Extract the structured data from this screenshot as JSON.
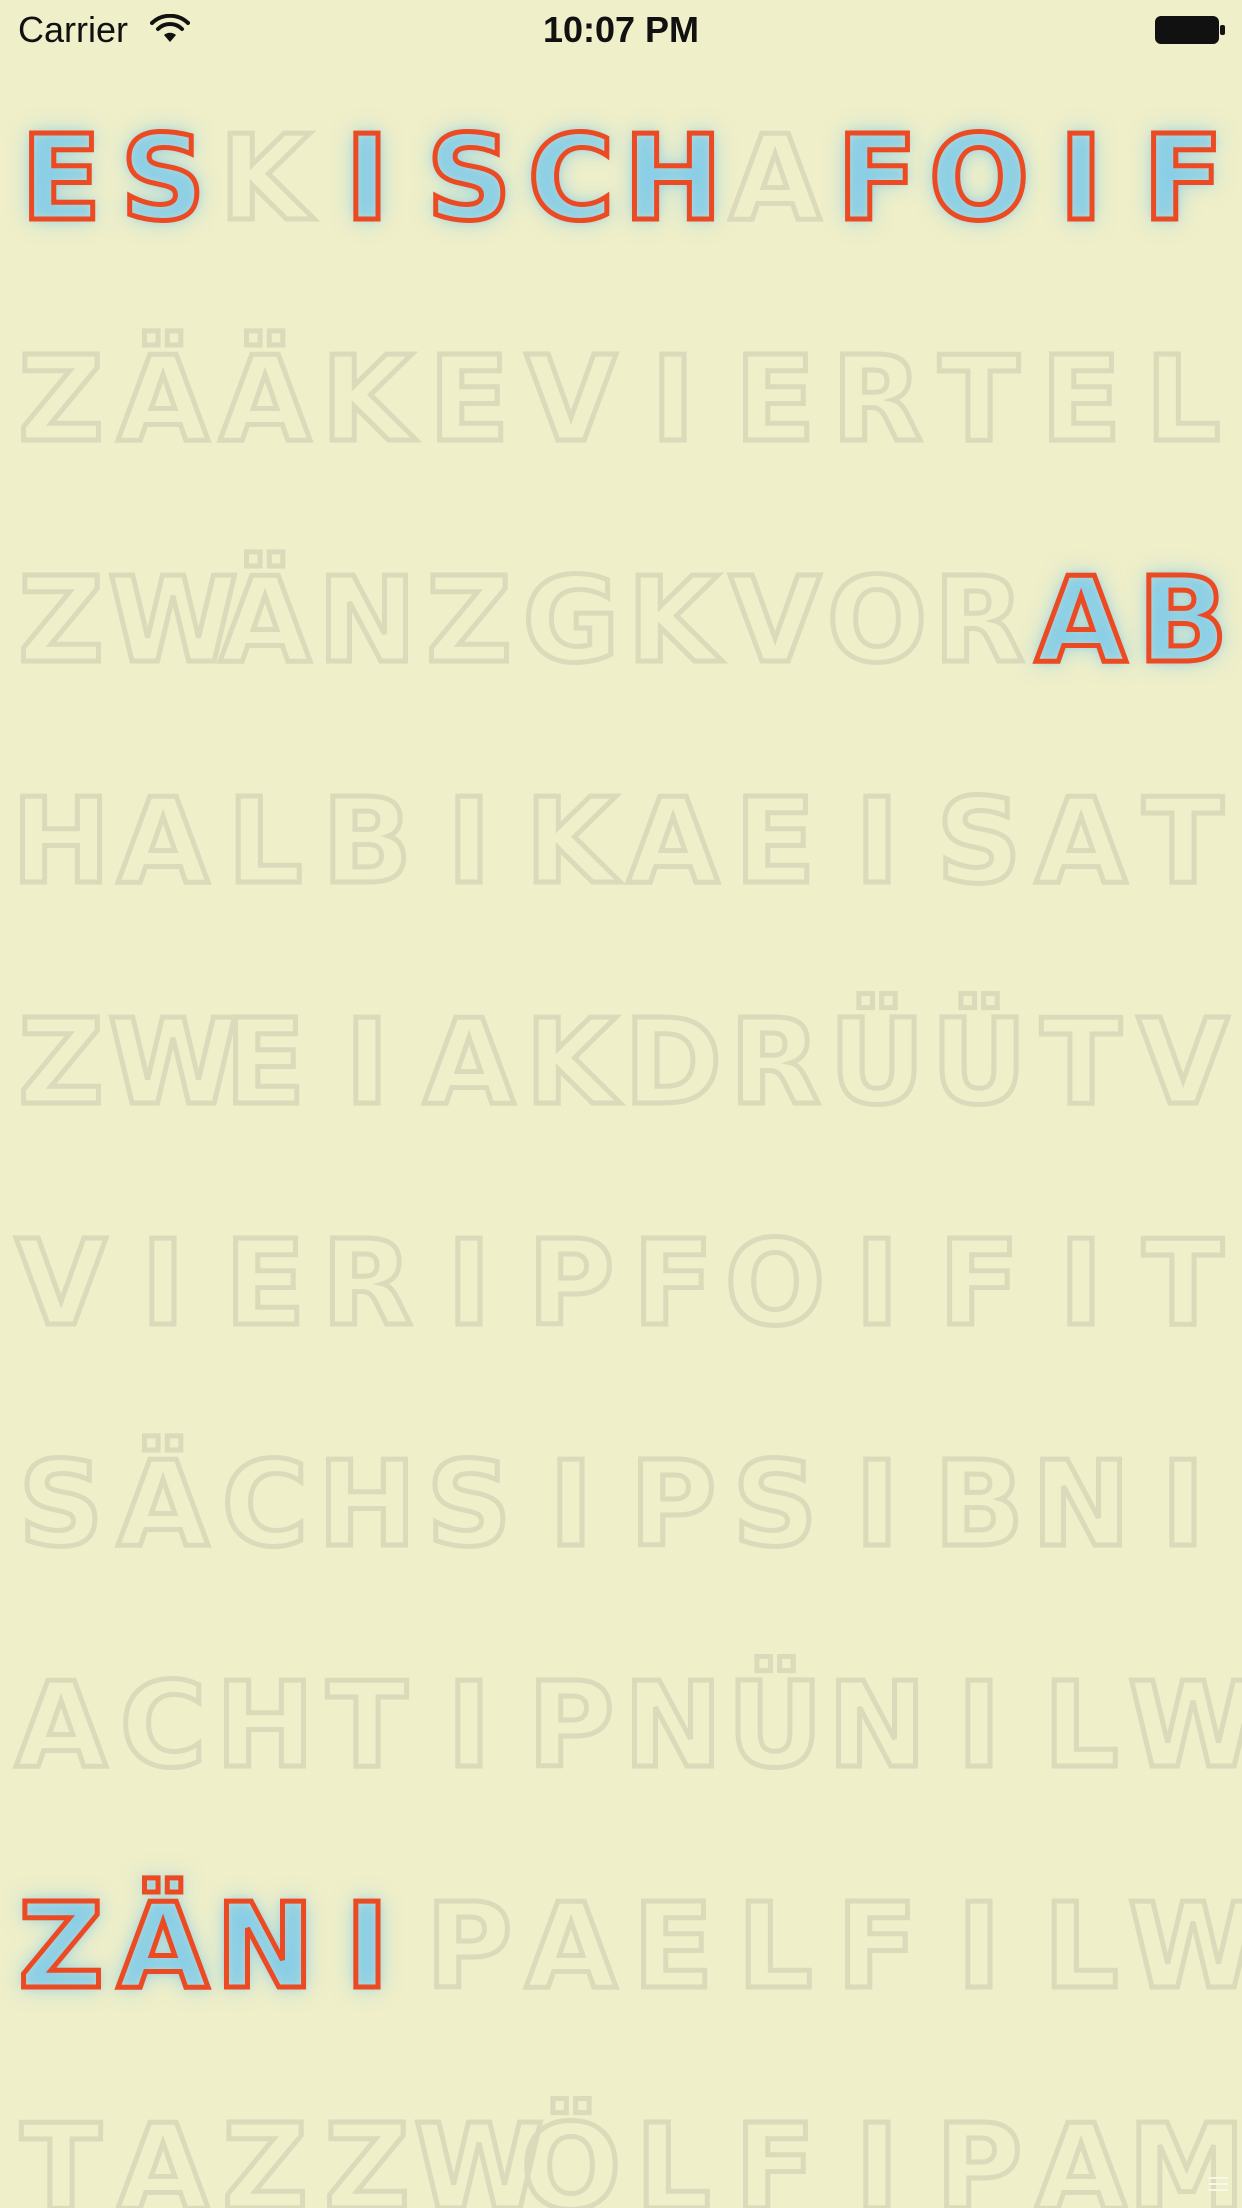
{
  "status_bar": {
    "carrier": "Carrier",
    "time": "10:07 PM",
    "wifi_icon": "wifi-icon",
    "battery_icon": "battery-icon"
  },
  "colors": {
    "background": "#efefc9",
    "letter_inactive": "#dbdabb",
    "letter_active": "#ec4a22",
    "glow": "#78c8eb"
  },
  "word_clock": {
    "rows": [
      {
        "letters": [
          "E",
          "S",
          "K",
          "I",
          "S",
          "C",
          "H",
          "A",
          "F",
          "O",
          "I",
          "F"
        ],
        "active": [
          true,
          true,
          false,
          true,
          true,
          true,
          true,
          false,
          true,
          true,
          true,
          true
        ]
      },
      {
        "letters": [
          "Z",
          "Ä",
          "Ä",
          "K",
          "E",
          "V",
          "I",
          "E",
          "R",
          "T",
          "E",
          "L"
        ],
        "active": [
          false,
          false,
          false,
          false,
          false,
          false,
          false,
          false,
          false,
          false,
          false,
          false
        ]
      },
      {
        "letters": [
          "Z",
          "W",
          "Ä",
          "N",
          "Z",
          "G",
          "K",
          "V",
          "O",
          "R",
          "A",
          "B"
        ],
        "active": [
          false,
          false,
          false,
          false,
          false,
          false,
          false,
          false,
          false,
          false,
          true,
          true
        ]
      },
      {
        "letters": [
          "H",
          "A",
          "L",
          "B",
          "I",
          "K",
          "A",
          "E",
          "I",
          "S",
          "A",
          "T"
        ],
        "active": [
          false,
          false,
          false,
          false,
          false,
          false,
          false,
          false,
          false,
          false,
          false,
          false
        ]
      },
      {
        "letters": [
          "Z",
          "W",
          "E",
          "I",
          "A",
          "K",
          "D",
          "R",
          "Ü",
          "Ü",
          "T",
          "V"
        ],
        "active": [
          false,
          false,
          false,
          false,
          false,
          false,
          false,
          false,
          false,
          false,
          false,
          false
        ]
      },
      {
        "letters": [
          "V",
          "I",
          "E",
          "R",
          "I",
          "P",
          "F",
          "O",
          "I",
          "F",
          "I",
          "T"
        ],
        "active": [
          false,
          false,
          false,
          false,
          false,
          false,
          false,
          false,
          false,
          false,
          false,
          false
        ]
      },
      {
        "letters": [
          "S",
          "Ä",
          "C",
          "H",
          "S",
          "I",
          "P",
          "S",
          "I",
          "B",
          "N",
          "I"
        ],
        "active": [
          false,
          false,
          false,
          false,
          false,
          false,
          false,
          false,
          false,
          false,
          false,
          false
        ]
      },
      {
        "letters": [
          "A",
          "C",
          "H",
          "T",
          "I",
          "P",
          "N",
          "Ü",
          "N",
          "I",
          "L",
          "W"
        ],
        "active": [
          false,
          false,
          false,
          false,
          false,
          false,
          false,
          false,
          false,
          false,
          false,
          false
        ]
      },
      {
        "letters": [
          "Z",
          "Ä",
          "N",
          "I",
          "P",
          "A",
          "E",
          "L",
          "F",
          "I",
          "L",
          "W"
        ],
        "active": [
          true,
          true,
          true,
          true,
          false,
          false,
          false,
          false,
          false,
          false,
          false,
          false
        ]
      },
      {
        "letters": [
          "T",
          "A",
          "Z",
          "Z",
          "W",
          "Ö",
          "L",
          "F",
          "I",
          "P",
          "A",
          "M"
        ],
        "active": [
          false,
          false,
          false,
          false,
          false,
          false,
          false,
          false,
          false,
          false,
          false,
          false
        ]
      }
    ]
  },
  "menu_handle_icon": "menu-lines-icon"
}
